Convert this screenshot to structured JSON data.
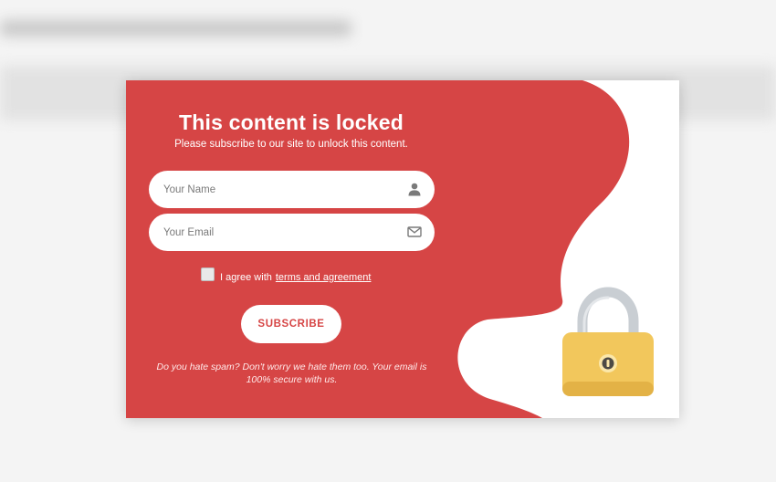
{
  "popup": {
    "title": "This content is locked",
    "subtitle": "Please subscribe to our site to unlock this content.",
    "name_field": {
      "placeholder": "Your Name",
      "value": "",
      "icon": "user-icon"
    },
    "email_field": {
      "placeholder": "Your Email",
      "value": "",
      "icon": "envelope-icon"
    },
    "agreement": {
      "checked": false,
      "text": "I agree with",
      "link_text": "terms and agreement"
    },
    "subscribe_label": "SUBSCRIBE",
    "note": "Do you hate spam? Don't worry we hate them too. Your email is 100% secure with us.",
    "lock_icon": "padlock-icon"
  },
  "colors": {
    "accent": "#d64545",
    "card_background": "#ffffff",
    "lock_body": "#f2c75c",
    "lock_shackle": "#c9ced3"
  }
}
